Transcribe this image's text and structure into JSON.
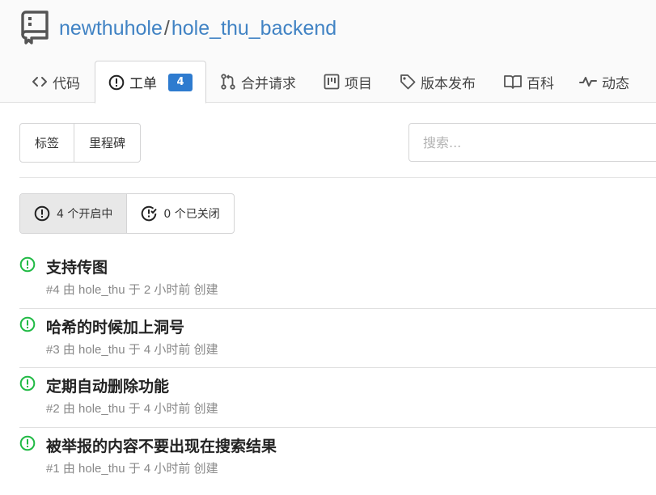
{
  "repo": {
    "owner": "newthuhole",
    "separator": "/",
    "name": "hole_thu_backend"
  },
  "tabs": [
    {
      "label": "代码",
      "icon": "code-icon"
    },
    {
      "label": "工单",
      "icon": "issue-opened-icon",
      "badge": "4"
    },
    {
      "label": "合并请求",
      "icon": "pull-request-icon"
    },
    {
      "label": "项目",
      "icon": "project-icon"
    },
    {
      "label": "版本发布",
      "icon": "tag-icon"
    },
    {
      "label": "百科",
      "icon": "book-icon"
    },
    {
      "label": "动态",
      "icon": "pulse-icon"
    }
  ],
  "toolbar": {
    "labels_label": "标签",
    "milestones_label": "里程碑",
    "search_placeholder": "搜索..."
  },
  "state_filter": {
    "open_label": "4 个开启中",
    "closed_label": "0 个已关闭"
  },
  "issues": [
    {
      "title": "支持传图",
      "meta": "#4 由 hole_thu 于 2 小时前 创建"
    },
    {
      "title": "哈希的时候加上洞号",
      "meta": "#3 由 hole_thu 于 4 小时前 创建"
    },
    {
      "title": "定期自动删除功能",
      "meta": "#2 由 hole_thu 于 4 小时前 创建"
    },
    {
      "title": "被举报的内容不要出现在搜索结果",
      "meta": "#1 由 hole_thu 于 4 小时前 创建"
    }
  ],
  "colors": {
    "link": "#4183c4",
    "badge": "#2e7bcf",
    "open_issue": "#21ba45"
  }
}
